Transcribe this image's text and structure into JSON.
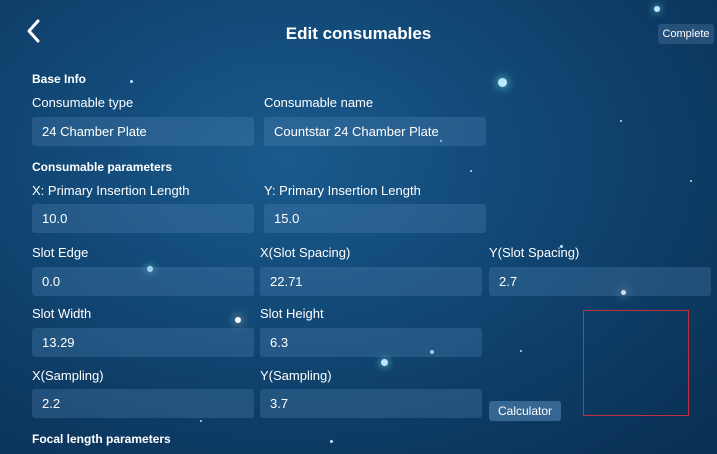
{
  "header": {
    "title": "Edit consumables",
    "complete_label": "Complete"
  },
  "base_info": {
    "heading": "Base Info",
    "type_label": "Consumable type",
    "type_value": "24 Chamber Plate",
    "name_label": "Consumable name",
    "name_value": "Countstar 24 Chamber Plate"
  },
  "params": {
    "heading": "Consumable parameters",
    "x_insertion_label": "X: Primary Insertion Length",
    "x_insertion_value": "10.0",
    "y_insertion_label": "Y: Primary Insertion Length",
    "y_insertion_value": "15.0",
    "slot_edge_label": "Slot Edge",
    "slot_edge_value": "0.0",
    "x_spacing_label": "X(Slot Spacing)",
    "x_spacing_value": "22.71",
    "y_spacing_label": "Y(Slot Spacing)",
    "y_spacing_value": "2.7",
    "slot_width_label": "Slot Width",
    "slot_width_value": "13.29",
    "slot_height_label": "Slot Height",
    "slot_height_value": "6.3",
    "x_sampling_label": "X(Sampling)",
    "x_sampling_value": "2.2",
    "y_sampling_label": "Y(Sampling)",
    "y_sampling_value": "3.7",
    "calculator_label": "Calculator"
  },
  "focal": {
    "heading": "Focal length parameters"
  },
  "icons": {
    "back": "chevron-left-icon"
  },
  "colors": {
    "background": "#124a78",
    "field": "#5a8cb9",
    "highlight_box": "#c0303a"
  }
}
